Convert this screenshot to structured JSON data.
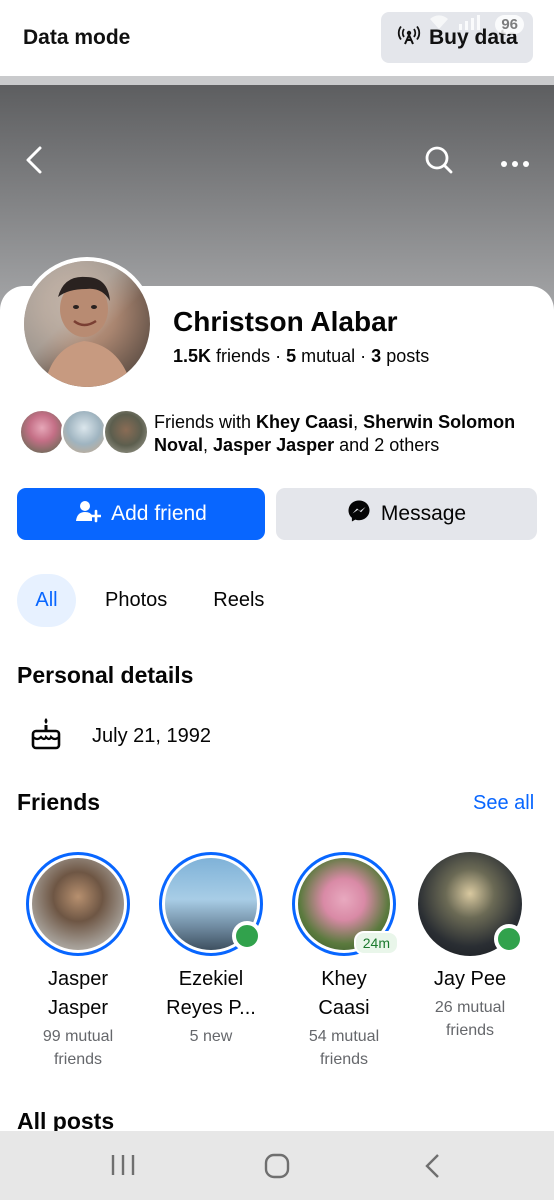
{
  "status_bar": {
    "data_mode_label": "Data mode",
    "buy_data_label": "Buy data",
    "battery": "96"
  },
  "profile": {
    "name": "Christson Alabar",
    "friends_count": "1.5K",
    "friends_word": "friends",
    "mutual_count": "5",
    "mutual_word": "mutual",
    "posts_count": "3",
    "posts_word": "posts",
    "mutual_prefix": "Friends with",
    "mutual_friend_1": "Khey Caasi",
    "mutual_friend_2": "Sherwin Solomon Noval",
    "mutual_friend_3": "Jasper Jasper",
    "mutual_suffix": "and 2 others"
  },
  "actions": {
    "add_friend": "Add friend",
    "message": "Message"
  },
  "tabs": [
    {
      "label": "All",
      "active": true
    },
    {
      "label": "Photos",
      "active": false
    },
    {
      "label": "Reels",
      "active": false
    }
  ],
  "personal_details": {
    "title": "Personal details",
    "birthday": "July 21, 1992"
  },
  "friends_section": {
    "title": "Friends",
    "see_all": "See all",
    "items": [
      {
        "name_line1": "Jasper",
        "name_line2": "Jasper",
        "sub_line1": "99 mutual",
        "sub_line2": "friends",
        "has_story_ring": true,
        "status": ""
      },
      {
        "name_line1": "Ezekiel",
        "name_line2": "Reyes P...",
        "sub_line1": "5 new",
        "sub_line2": "",
        "has_story_ring": true,
        "status": "online"
      },
      {
        "name_line1": "Khey",
        "name_line2": "Caasi",
        "sub_line1": "54 mutual",
        "sub_line2": "friends",
        "has_story_ring": true,
        "status": "24m"
      },
      {
        "name_line1": "Jay Pee",
        "name_line2": "",
        "sub_line1": "26 mutual",
        "sub_line2": "friends",
        "has_story_ring": false,
        "status": "online"
      }
    ]
  },
  "all_posts_title": "All posts",
  "colors": {
    "accent": "#0866ff",
    "online": "#31a24c",
    "secondary_button": "#e4e6eb",
    "muted_text": "#65676b"
  }
}
